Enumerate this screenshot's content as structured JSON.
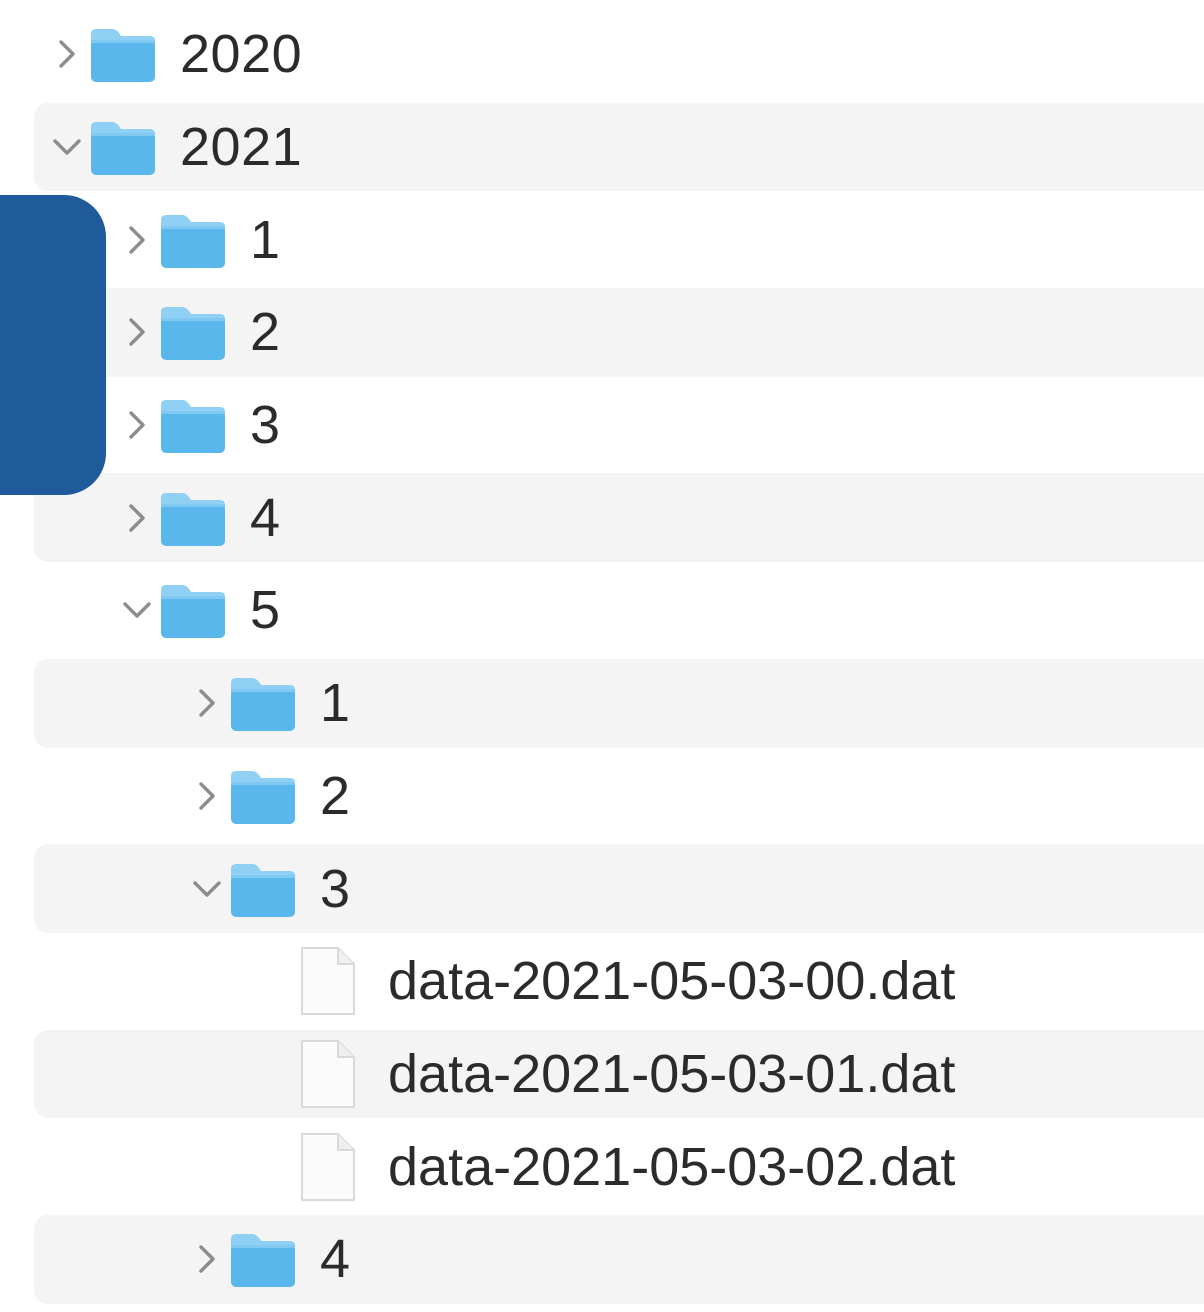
{
  "colors": {
    "folder_top": "#8fd0f4",
    "folder_body": "#5ab7ec",
    "chevron": "#8c8c8c",
    "row_shade": "#f4f4f5",
    "overlay": "#1f5a9a",
    "text": "#2b2b2b"
  },
  "tree": [
    {
      "kind": "folder",
      "depth": 0,
      "expanded": false,
      "label": "2020",
      "icon": "chevron-right-icon"
    },
    {
      "kind": "folder",
      "depth": 0,
      "expanded": true,
      "label": "2021",
      "icon": "chevron-down-icon"
    },
    {
      "kind": "folder",
      "depth": 1,
      "expanded": false,
      "label": "1",
      "icon": "chevron-right-icon"
    },
    {
      "kind": "folder",
      "depth": 1,
      "expanded": false,
      "label": "2",
      "icon": "chevron-right-icon"
    },
    {
      "kind": "folder",
      "depth": 1,
      "expanded": false,
      "label": "3",
      "icon": "chevron-right-icon"
    },
    {
      "kind": "folder",
      "depth": 1,
      "expanded": false,
      "label": "4",
      "icon": "chevron-right-icon"
    },
    {
      "kind": "folder",
      "depth": 1,
      "expanded": true,
      "label": "5",
      "icon": "chevron-down-icon"
    },
    {
      "kind": "folder",
      "depth": 2,
      "expanded": false,
      "label": "1",
      "icon": "chevron-right-icon"
    },
    {
      "kind": "folder",
      "depth": 2,
      "expanded": false,
      "label": "2",
      "icon": "chevron-right-icon"
    },
    {
      "kind": "folder",
      "depth": 2,
      "expanded": true,
      "label": "3",
      "icon": "chevron-down-icon"
    },
    {
      "kind": "file",
      "depth": 3,
      "label": "data-2021-05-03-00.dat",
      "icon": "document-icon"
    },
    {
      "kind": "file",
      "depth": 3,
      "label": "data-2021-05-03-01.dat",
      "icon": "document-icon"
    },
    {
      "kind": "file",
      "depth": 3,
      "label": "data-2021-05-03-02.dat",
      "icon": "document-icon"
    },
    {
      "kind": "folder",
      "depth": 2,
      "expanded": false,
      "label": "4",
      "icon": "chevron-right-icon"
    }
  ]
}
